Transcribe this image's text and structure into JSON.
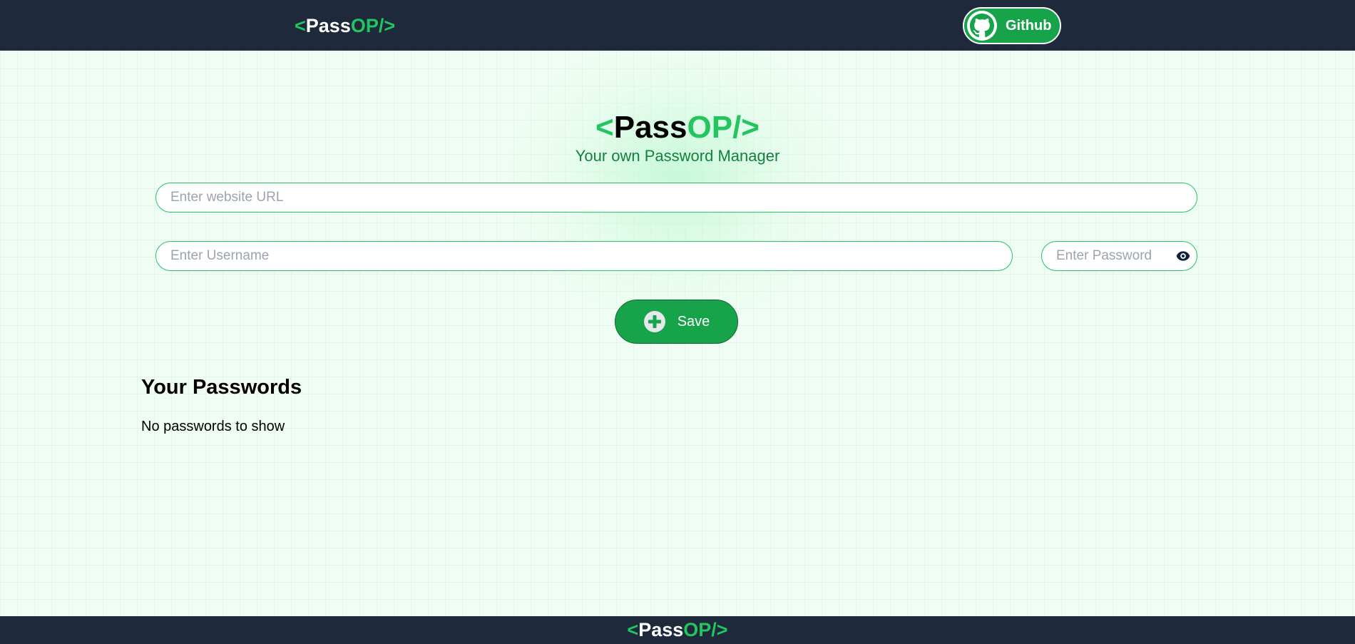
{
  "brand": {
    "open": "<",
    "pass": "Pass",
    "op": "OP",
    "close": "/>"
  },
  "navbar": {
    "github_label": "Github"
  },
  "hero": {
    "tagline": "Your own Password Manager"
  },
  "form": {
    "url_placeholder": "Enter website URL",
    "username_placeholder": "Enter Username",
    "password_placeholder": "Enter Password",
    "save_label": "Save"
  },
  "passwords": {
    "heading": "Your Passwords",
    "empty_message": "No passwords to show"
  },
  "icons": {
    "github": "github-icon",
    "eye": "eye-icon",
    "add": "plus-circle-icon"
  },
  "colors": {
    "navy": "#1e293b",
    "green": "#22c55e",
    "green_dark": "#16a34a",
    "bg": "#f0fdf4"
  }
}
